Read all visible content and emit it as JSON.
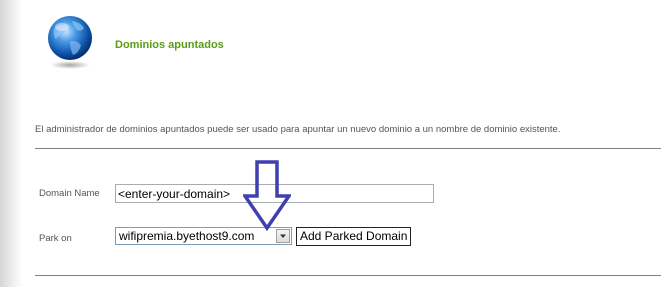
{
  "header": {
    "title": "Dominios apuntados",
    "icon": "globe-icon"
  },
  "description": "El administrador de dominios apuntados puede ser usado para apuntar un nuevo dominio a un nombre de dominio existente.",
  "form": {
    "domain_label": "Domain Name",
    "domain_value": "<enter-your-domain>",
    "park_label": "Park on",
    "park_selected": "wifipremia.byethost9.com",
    "add_button_label": "Add Parked Domain"
  },
  "annotation": {
    "icon": "down-arrow-icon",
    "color": "#3f3fb0"
  },
  "colors": {
    "title": "#5a9c12",
    "text": "#555555",
    "divider": "#808080"
  }
}
